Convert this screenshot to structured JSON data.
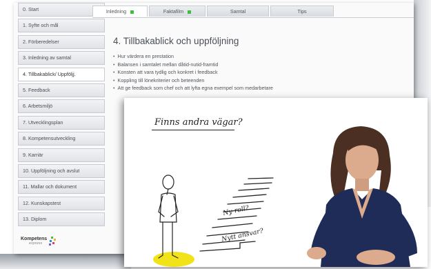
{
  "sidebar": {
    "items": [
      {
        "label": "0.  Start",
        "active": false,
        "done": true
      },
      {
        "label": "1.  Syfte och mål"
      },
      {
        "label": "2.  Förberedelser"
      },
      {
        "label": "3.  Inledning av samtal"
      },
      {
        "label": "4.  Tillbakablick/ Uppföljj.",
        "active": true
      },
      {
        "label": "5.  Feedback"
      },
      {
        "label": "6.  Arbetsmiljö"
      },
      {
        "label": "7.  Utvecklingsplan"
      },
      {
        "label": "8.  Kompetensutveckling"
      },
      {
        "label": "9.  Karriär"
      },
      {
        "label": "10. Uppföljning och avslut"
      },
      {
        "label": "11. Mallar och dokument"
      },
      {
        "label": "12. Kunskapstest"
      },
      {
        "label": "13. Diplom"
      }
    ],
    "logo": {
      "main": "Kompetens",
      "sub": "express"
    }
  },
  "tabs": [
    {
      "label": "Inledning",
      "active": true,
      "done": true
    },
    {
      "label": "Faktafilm",
      "done": true
    },
    {
      "label": "Samtal"
    },
    {
      "label": "Tips"
    }
  ],
  "content": {
    "title": "4. Tillbakablick och uppföljning",
    "bullets": [
      "Hur värdera en prestation",
      "Balansen i samtalet mellan dåtid-nutid-framtid",
      "Konsten att vara tydlig och konkret i feedback",
      "Koppling till lönekriterier och beteenden",
      "Att ge feedback som chef och att lyfta egna exempel som medarbetare"
    ]
  },
  "video": {
    "title": "Finns andra vägar?",
    "step_labels": [
      "Ny roll?",
      "Nytt ansvar?"
    ]
  },
  "colors": {
    "accent_green": "#3fbf3f",
    "highlight_yellow": "#f2e21a"
  }
}
